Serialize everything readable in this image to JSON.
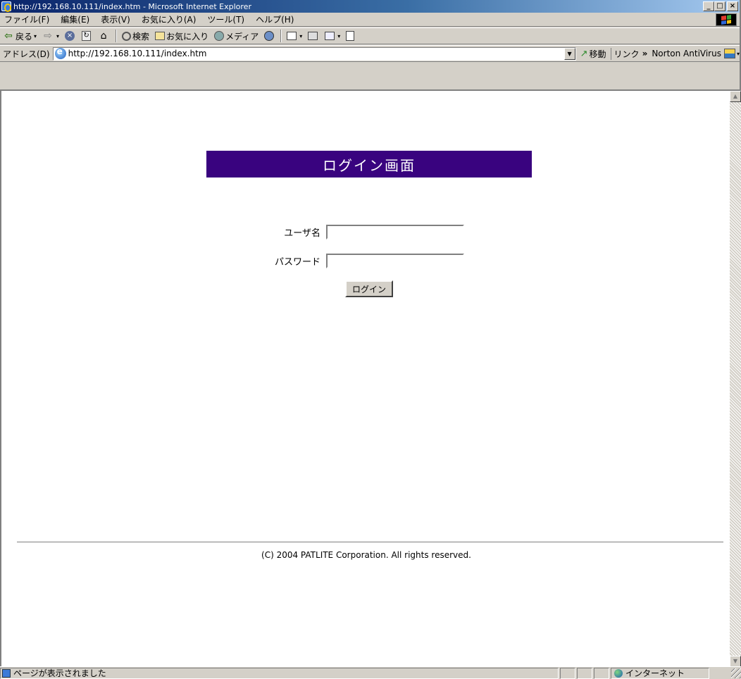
{
  "window": {
    "title": "http://192.168.10.111/index.htm - Microsoft Internet Explorer",
    "minimize": "_",
    "maximize": "□",
    "close": "×"
  },
  "menu": [
    "ファイル(F)",
    "編集(E)",
    "表示(V)",
    "お気に入り(A)",
    "ツール(T)",
    "ヘルプ(H)"
  ],
  "toolbar": {
    "back_label": "戻る",
    "search_label": "検索",
    "favorites_label": "お気に入り",
    "media_label": "メディア",
    "arrow": "▾"
  },
  "address": {
    "label": "アドレス(D)",
    "url": "http://192.168.10.111/index.htm",
    "go_label": "移動",
    "links_label": "リンク",
    "links_chevron": "»",
    "norton_label": "Norton AntiVirus"
  },
  "page": {
    "banner_title": "ログイン画面",
    "username_label": "ユーザ名",
    "password_label": "パスワード",
    "username_value": "",
    "password_value": "",
    "login_button": "ログイン",
    "copyright": "(C) 2004 PATLITE Corporation. All rights reserved."
  },
  "status": {
    "message": "ページが表示されました",
    "zone": "インターネット"
  },
  "colors": {
    "banner_bg": "#39037f",
    "titlebar_start": "#0a246a",
    "chrome": "#d4d0c8"
  }
}
